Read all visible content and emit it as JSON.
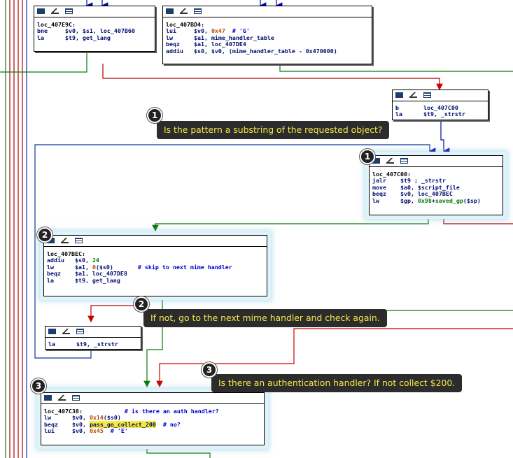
{
  "nodes": {
    "n1": {
      "label": "loc_407E9C:",
      "lines": [
        [
          {
            "t": "bne     $v0, $s1, loc_407B60"
          }
        ],
        [
          {
            "t": "la      $t9, get_lang"
          }
        ]
      ]
    },
    "n2": {
      "label": "loc_407BD4:",
      "lines": [
        [
          {
            "t": "lui     $v0, "
          },
          {
            "t": "0x47",
            "c": "c-hex"
          },
          {
            "t": "  # 'G'",
            "c": "c-cmt"
          }
        ],
        [
          {
            "t": "lw      $a1, mime_handler_table"
          }
        ],
        [
          {
            "t": "beqz    $a1, loc_407DE4"
          }
        ],
        [
          {
            "t": "addiu   $s0, $v0, (mime_handler_table - 0x470000)"
          }
        ]
      ]
    },
    "n3": {
      "label": "",
      "lines": [
        [
          {
            "t": "b       loc_407C00"
          }
        ],
        [
          {
            "t": "la      $t9, _strstr"
          }
        ]
      ]
    },
    "n4": {
      "label": "loc_407C00:",
      "lines": [
        [
          {
            "t": "jalr    $t9 ; _strstr"
          }
        ],
        [
          {
            "t": "move    $a0, $script_file"
          }
        ],
        [
          {
            "t": "beqz    $v0, loc_407BEC"
          }
        ],
        [
          {
            "t": "lw      $gp, "
          },
          {
            "t": "0x98",
            "c": "c-num"
          },
          {
            "t": "+"
          },
          {
            "t": "saved_gp",
            "c": "c-num"
          },
          {
            "t": "($sp)"
          }
        ]
      ]
    },
    "n5": {
      "label": "loc_407BEC:",
      "lines": [
        [
          {
            "t": "addiu   $s0, "
          },
          {
            "t": "24",
            "c": "c-num"
          }
        ],
        [
          {
            "t": "lw      $a1, "
          },
          {
            "t": "0",
            "c": "c-hex"
          },
          {
            "t": "($s0)       "
          },
          {
            "t": "# skip to next mime handler",
            "c": "c-cmt"
          }
        ],
        [
          {
            "t": "beqz    $a1, loc_407DE8"
          }
        ],
        [
          {
            "t": "la      $t9, get_lang"
          }
        ]
      ]
    },
    "n6": {
      "label": "",
      "lines": [
        [
          {
            "t": "la      $t9, _strstr"
          }
        ]
      ]
    },
    "n7": {
      "label": "loc_407C38:",
      "label_comment": "            # is there an auth handler?",
      "lines": [
        [
          {
            "t": "lw      $v0, "
          },
          {
            "t": "0x14",
            "c": "c-hex"
          },
          {
            "t": "($s0)"
          }
        ],
        [
          {
            "t": "beqz    $v0, "
          },
          {
            "t": "pass_go_collect_200",
            "c": "c-hl"
          },
          {
            "t": "  # no?",
            "c": "c-cmt"
          }
        ],
        [
          {
            "t": "lui     $v0, "
          },
          {
            "t": "0x45",
            "c": "c-hex"
          },
          {
            "t": "  # 'E'",
            "c": "c-cmt"
          }
        ]
      ]
    }
  },
  "callouts": {
    "c1": {
      "num": "1",
      "text": "Is the pattern a substring of the requested object?"
    },
    "c2": {
      "num": "2",
      "text": "If not, go to the next mime handler and check again."
    },
    "c3": {
      "num": "3",
      "text": "Is there an authentication handler? If not collect $200."
    }
  },
  "badges": {
    "b1": "1",
    "b2": "2",
    "b3": "3"
  },
  "colors": {
    "edge_true": "#0a7a0a",
    "edge_false": "#b00000",
    "edge_uncond": "#0000aa",
    "edge_back": "#0a3a9a",
    "callout_bg": "#2c2c2c",
    "callout_text": "#f4e84a",
    "highlight": "#f7ea3d",
    "node_glow": "#dff3fa"
  },
  "icons": [
    "graph-icon",
    "pen-icon",
    "list-icon"
  ]
}
